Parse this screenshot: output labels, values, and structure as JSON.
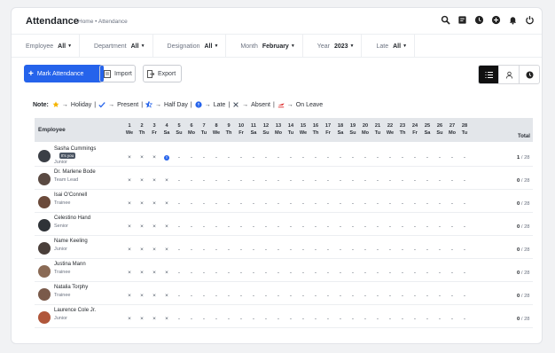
{
  "header": {
    "title": "Attendance",
    "breadcrumb": "Home • Attendance",
    "icons": [
      "search-icon",
      "notes-icon",
      "clock-icon",
      "add-icon",
      "bell-icon",
      "power-icon"
    ]
  },
  "filters": [
    {
      "label": "Employee",
      "value": "All"
    },
    {
      "label": "Department",
      "value": "All"
    },
    {
      "label": "Designation",
      "value": "All"
    },
    {
      "label": "Month",
      "value": "February"
    },
    {
      "label": "Year",
      "value": "2023"
    },
    {
      "label": "Late",
      "value": "All"
    }
  ],
  "actions": {
    "mark_label": "Mark Attendance",
    "import_label": "Import",
    "export_label": "Export",
    "accent": "#2563eb",
    "view_toggle": [
      "list-view-icon",
      "user-view-icon",
      "clock-view-icon"
    ]
  },
  "legend": {
    "prefix": "Note:",
    "arrow": "→",
    "items": [
      {
        "icon": "star-icon",
        "label": "Holiday",
        "color": "#f5b400"
      },
      {
        "icon": "check-icon",
        "label": "Present",
        "color": "#2563eb"
      },
      {
        "icon": "half-star-icon",
        "label": "Half Day",
        "color": "#2563eb"
      },
      {
        "icon": "late-icon",
        "label": "Late",
        "color": "#2563eb"
      },
      {
        "icon": "cross-icon",
        "label": "Absent",
        "color": "#4b5563"
      },
      {
        "icon": "plane-icon",
        "label": "On Leave",
        "color": "#dc2626"
      }
    ]
  },
  "table": {
    "employee_header": "Employee",
    "total_header": "Total",
    "days": [
      {
        "n": "1",
        "d": "We"
      },
      {
        "n": "2",
        "d": "Th"
      },
      {
        "n": "3",
        "d": "Fr"
      },
      {
        "n": "4",
        "d": "Sa"
      },
      {
        "n": "5",
        "d": "Su"
      },
      {
        "n": "6",
        "d": "Mo"
      },
      {
        "n": "7",
        "d": "Tu"
      },
      {
        "n": "8",
        "d": "We"
      },
      {
        "n": "9",
        "d": "Th"
      },
      {
        "n": "10",
        "d": "Fr"
      },
      {
        "n": "11",
        "d": "Sa"
      },
      {
        "n": "12",
        "d": "Su"
      },
      {
        "n": "13",
        "d": "Mo"
      },
      {
        "n": "14",
        "d": "Tu"
      },
      {
        "n": "15",
        "d": "We"
      },
      {
        "n": "16",
        "d": "Th"
      },
      {
        "n": "17",
        "d": "Fr"
      },
      {
        "n": "18",
        "d": "Sa"
      },
      {
        "n": "19",
        "d": "Su"
      },
      {
        "n": "20",
        "d": "Mo"
      },
      {
        "n": "21",
        "d": "Tu"
      },
      {
        "n": "22",
        "d": "We"
      },
      {
        "n": "23",
        "d": "Th"
      },
      {
        "n": "24",
        "d": "Fr"
      },
      {
        "n": "25",
        "d": "Sa"
      },
      {
        "n": "26",
        "d": "Su"
      },
      {
        "n": "27",
        "d": "Mo"
      },
      {
        "n": "28",
        "d": "Tu"
      }
    ],
    "rows": [
      {
        "name": "Sasha Cummings",
        "badge": "It's you",
        "role": "Junior",
        "marks": [
          "×",
          "×",
          "×",
          "late",
          "-",
          "-",
          "-",
          "-",
          "-",
          "-",
          "-",
          "-",
          "-",
          "-",
          "-",
          "-",
          "-",
          "-",
          "-",
          "-",
          "-",
          "-",
          "-",
          "-",
          "-",
          "-",
          "-",
          "-"
        ],
        "present": "1",
        "total": "/ 28",
        "avatar": "#3b3f46"
      },
      {
        "name": "Dr. Marlene Bode",
        "role": "Team Lead",
        "marks": [
          "×",
          "×",
          "×",
          "×",
          "-",
          "-",
          "-",
          "-",
          "-",
          "-",
          "-",
          "-",
          "-",
          "-",
          "-",
          "-",
          "-",
          "-",
          "-",
          "-",
          "-",
          "-",
          "-",
          "-",
          "-",
          "-",
          "-",
          "-"
        ],
        "present": "0",
        "total": "/ 28",
        "avatar": "#5a4a42"
      },
      {
        "name": "Isai O'Connell",
        "role": "Trainee",
        "marks": [
          "×",
          "×",
          "×",
          "×",
          "-",
          "-",
          "-",
          "-",
          "-",
          "-",
          "-",
          "-",
          "-",
          "-",
          "-",
          "-",
          "-",
          "-",
          "-",
          "-",
          "-",
          "-",
          "-",
          "-",
          "-",
          "-",
          "-",
          "-"
        ],
        "present": "0",
        "total": "/ 28",
        "avatar": "#6b4a3a"
      },
      {
        "name": "Celestino Hand",
        "role": "Senior",
        "marks": [
          "×",
          "×",
          "×",
          "×",
          "-",
          "-",
          "-",
          "-",
          "-",
          "-",
          "-",
          "-",
          "-",
          "-",
          "-",
          "-",
          "-",
          "-",
          "-",
          "-",
          "-",
          "-",
          "-",
          "-",
          "-",
          "-",
          "-",
          "-"
        ],
        "present": "0",
        "total": "/ 28",
        "avatar": "#2f3338"
      },
      {
        "name": "Name Keeling",
        "role": "Junior",
        "marks": [
          "×",
          "×",
          "×",
          "×",
          "-",
          "-",
          "-",
          "-",
          "-",
          "-",
          "-",
          "-",
          "-",
          "-",
          "-",
          "-",
          "-",
          "-",
          "-",
          "-",
          "-",
          "-",
          "-",
          "-",
          "-",
          "-",
          "-",
          "-"
        ],
        "present": "0",
        "total": "/ 28",
        "avatar": "#4a3f3a"
      },
      {
        "name": "Justina Mann",
        "role": "Trainee",
        "marks": [
          "×",
          "×",
          "×",
          "×",
          "-",
          "-",
          "-",
          "-",
          "-",
          "-",
          "-",
          "-",
          "-",
          "-",
          "-",
          "-",
          "-",
          "-",
          "-",
          "-",
          "-",
          "-",
          "-",
          "-",
          "-",
          "-",
          "-",
          "-"
        ],
        "present": "0",
        "total": "/ 28",
        "avatar": "#8a6a55"
      },
      {
        "name": "Natalia Torphy",
        "role": "Trainee",
        "marks": [
          "×",
          "×",
          "×",
          "×",
          "-",
          "-",
          "-",
          "-",
          "-",
          "-",
          "-",
          "-",
          "-",
          "-",
          "-",
          "-",
          "-",
          "-",
          "-",
          "-",
          "-",
          "-",
          "-",
          "-",
          "-",
          "-",
          "-",
          "-"
        ],
        "present": "0",
        "total": "/ 28",
        "avatar": "#7a5a4a"
      },
      {
        "name": "Laurence Cole Jr.",
        "role": "Junior",
        "marks": [
          "×",
          "×",
          "×",
          "×",
          "-",
          "-",
          "-",
          "-",
          "-",
          "-",
          "-",
          "-",
          "-",
          "-",
          "-",
          "-",
          "-",
          "-",
          "-",
          "-",
          "-",
          "-",
          "-",
          "-",
          "-",
          "-",
          "-",
          "-"
        ],
        "present": "0",
        "total": "/ 28",
        "avatar": "#b0563a"
      }
    ]
  }
}
